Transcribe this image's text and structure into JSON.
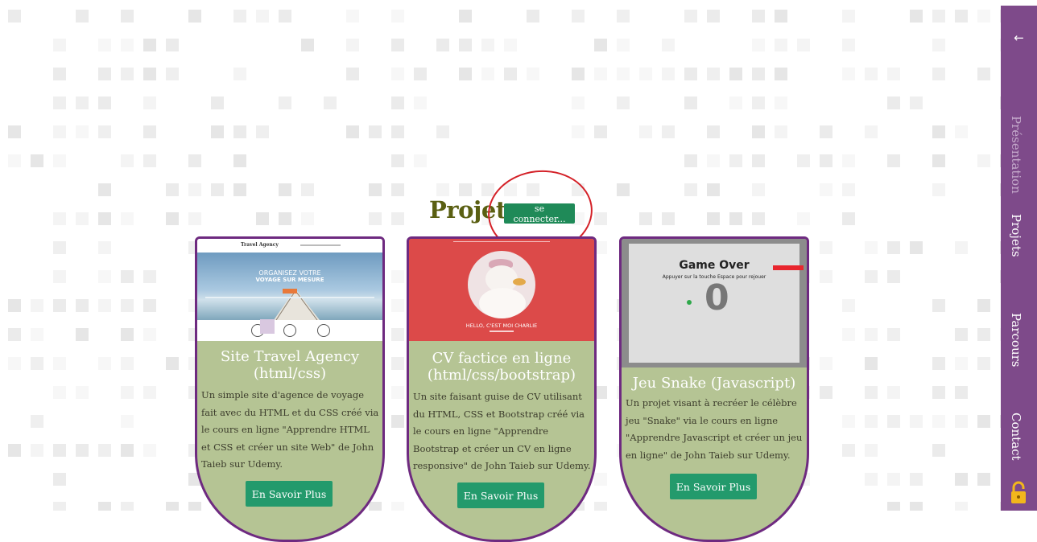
{
  "section": {
    "title": "Projets",
    "connect_label": "se connecter..."
  },
  "projects": [
    {
      "title": "Site Travel Agency (html/css)",
      "description": "Un simple site d'agence de voyage fait avec du HTML et du CSS créé via le cours en ligne \"Apprendre HTML et CSS et créer un site Web\" de John Taieb sur Udemy.",
      "button_label": "En Savoir Plus",
      "thumb": {
        "site_name": "Travel Agency",
        "hero_line1": "ORGANISEZ VOTRE",
        "hero_line2": "VOYAGE SUR MESURE"
      }
    },
    {
      "title": "CV factice en ligne (html/css/bootstrap)",
      "description": "Un site faisant guise de CV utilisant du HTML, CSS et Bootstrap créé via le cours en ligne \"Apprendre Bootstrap et créer un CV en ligne responsive\" de John Taieb sur Udemy.",
      "button_label": "En Savoir Plus",
      "thumb": {
        "hello": "HELLO, C'EST MOI CHARLIE"
      }
    },
    {
      "title": "Jeu Snake (Javascript)",
      "description": "Un projet visant à recréer le célèbre jeu \"Snake\" via le cours en ligne \"Apprendre Javascript et créer un jeu en ligne\" de John Taieb sur Udemy.",
      "button_label": "En Savoir Plus",
      "thumb": {
        "game_over": "Game Over",
        "instruction": "Appuyer sur la touche Espace pour rejouer",
        "score": "0"
      }
    }
  ],
  "sidebar": {
    "items": [
      {
        "label": "Présentation",
        "active": false
      },
      {
        "label": "Projets",
        "active": true
      },
      {
        "label": "Parcours",
        "active": true
      },
      {
        "label": "Contact",
        "active": true
      }
    ],
    "back_icon": "arrow-left-icon",
    "lock_icon": "lock-icon"
  },
  "colors": {
    "title": "#5a5f12",
    "card_bg": "#b5c494",
    "card_border": "#6e2a80",
    "button": "#239a6c",
    "sidebar": "#7e4a8a",
    "annotation": "#d42128"
  }
}
